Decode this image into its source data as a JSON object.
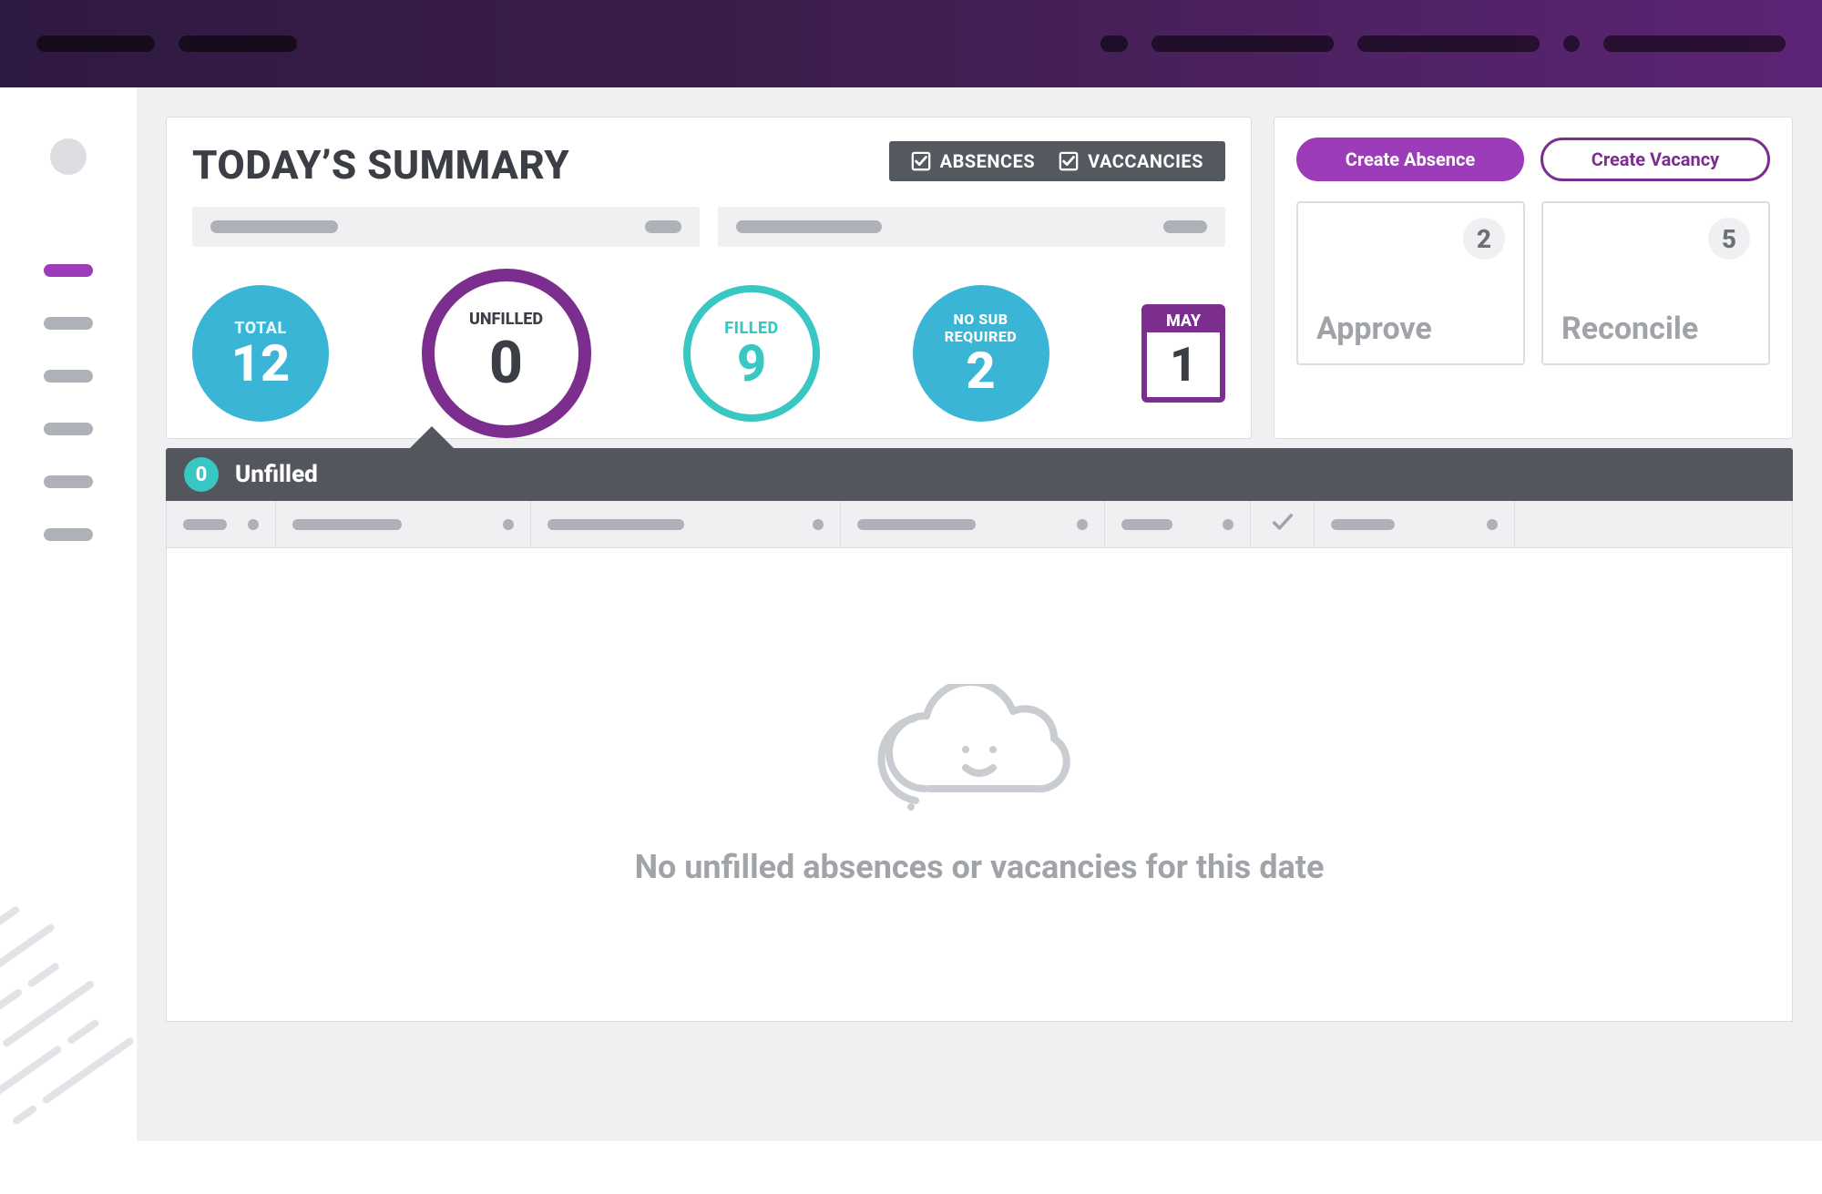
{
  "colors": {
    "purple": "#7b2e8e",
    "purple_bright": "#9c3cb8",
    "teal": "#39c7c3",
    "blue": "#3ab5d6"
  },
  "summary": {
    "title": "TODAY’S SUMMARY",
    "toggles": {
      "absences": "ABSENCES",
      "vacancies": "VACCANCIES"
    },
    "stats": {
      "total": {
        "label": "TOTAL",
        "value": "12"
      },
      "unfilled": {
        "label": "UNFILLED",
        "value": "0"
      },
      "filled": {
        "label": "FILLED",
        "value": "9"
      },
      "nosub": {
        "label_line1": "NO SUB",
        "label_line2": "REQUIRED",
        "value": "2"
      }
    },
    "calendar": {
      "month": "MAY",
      "day": "1"
    }
  },
  "tab": {
    "badge": "0",
    "title": "Unfilled"
  },
  "empty_message": "No unfilled absences or vacancies for this date",
  "actions": {
    "create_absence": "Create Absence",
    "create_vacancy": "Create Vacancy"
  },
  "tiles": {
    "approve": {
      "label": "Approve",
      "count": "2"
    },
    "reconcile": {
      "label": "Reconcile",
      "count": "5"
    }
  }
}
